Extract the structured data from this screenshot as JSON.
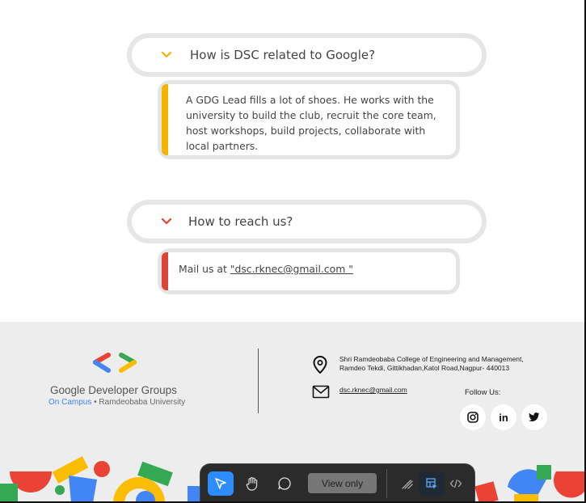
{
  "faq": [
    {
      "question": "How is DSC related to Google?",
      "answer": "A GDG Lead fills a lot of shoes. He works with the university to build the club, recruit the core team, host workshops, build projects, collaborate with local partners.",
      "accent": "#F4B400"
    },
    {
      "question": "How to reach us?",
      "answer_prefix": "Mail us at ",
      "answer_link": "\"dsc.rknec@gmail.com \"",
      "accent": "#DB4437"
    }
  ],
  "footer": {
    "brand_name": "Google Developer Groups",
    "brand_sub_highlight": "On Campus",
    "brand_sub_rest": " • Ramdeobaba University",
    "address_line1": "Shri Ramdeobaba College of Engineering and Management,",
    "address_line2": "Ramdeo Tekdi, Gittikhadan,Katol Road,Nagpur- 440013",
    "email": "dsc.rknec@gmail.com",
    "follow_label": "Follow Us:",
    "social": [
      "instagram-icon",
      "linkedin-icon",
      "twitter-icon"
    ],
    "linkedin_text": "in"
  },
  "toolbar": {
    "view_only_label": "View only",
    "tools": [
      "pointer-icon",
      "hand-icon",
      "comment-icon",
      "draw-icon",
      "inspect-icon",
      "code-icon"
    ],
    "active_color": "#2D8CFF"
  },
  "brand_colors": {
    "blue": "#4285F4",
    "red": "#EA4335",
    "yellow": "#FBBC04",
    "green": "#34A853"
  }
}
